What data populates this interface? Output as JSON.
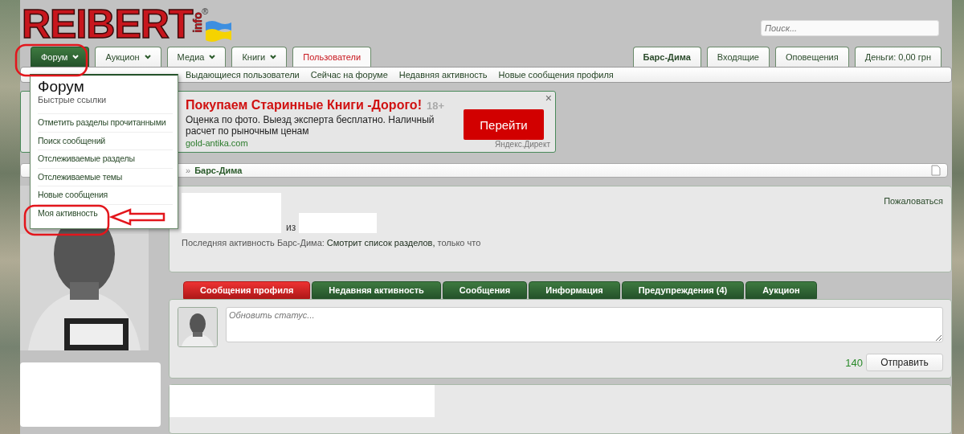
{
  "logo": {
    "wordmark": "REIBERT",
    "suffix": "info",
    "mark": "®"
  },
  "search": {
    "placeholder": "Поиск..."
  },
  "nav_tabs": [
    {
      "label": "Форум",
      "has_menu": true,
      "open": true,
      "selected": false
    },
    {
      "label": "Аукцион",
      "has_menu": true,
      "open": false,
      "selected": false
    },
    {
      "label": "Медиа",
      "has_menu": true,
      "open": false,
      "selected": false
    },
    {
      "label": "Книги",
      "has_menu": true,
      "open": false,
      "selected": false
    },
    {
      "label": "Пользователи",
      "has_menu": false,
      "open": false,
      "selected": true
    }
  ],
  "user_tabs": [
    {
      "label": "Барс-Дима",
      "kind": "account"
    },
    {
      "label": "Входящие",
      "kind": "link"
    },
    {
      "label": "Оповещения",
      "kind": "link"
    },
    {
      "label": "Деньги: 0,00 грн",
      "kind": "link"
    }
  ],
  "subnav": [
    "Выдающиеся пользователи",
    "Сейчас на форуме",
    "Недавняя активность",
    "Новые сообщения профиля"
  ],
  "menu": {
    "title": "Форум",
    "subtitle": "Быстрые ссылки",
    "items": [
      "Отметить разделы прочитанными",
      "Поиск сообщений",
      "Отслеживаемые разделы",
      "Отслеживаемые темы",
      "Новые сообщения",
      "Моя активность"
    ]
  },
  "ad": {
    "title": "Покупаем Старинные Книги -Дорого!",
    "age": "18+",
    "text": "Оценка по фото. Выезд эксперта бесплатно. Наличный расчет по рыночным ценам",
    "domain": "gold-antika.com",
    "button": "Перейти",
    "source": "Яндекс.Директ",
    "close": "×"
  },
  "breadcrumb": {
    "separator": "»",
    "items": [
      "Барс-Дима"
    ]
  },
  "profile": {
    "from_label": "из",
    "report": "Пожаловаться",
    "activity_label": "Последняя активность Барс-Дима:",
    "activity": "Смотрит список разделов,",
    "activity_time": "только что"
  },
  "profile_tabs": [
    {
      "label": "Сообщения профиля",
      "selected": true
    },
    {
      "label": "Недавняя активность",
      "selected": false
    },
    {
      "label": "Сообщения",
      "selected": false
    },
    {
      "label": "Информация",
      "selected": false
    },
    {
      "label": "Предупреждения (4)",
      "selected": false
    },
    {
      "label": "Аукцион",
      "selected": false
    }
  ],
  "status": {
    "placeholder": "Обновить статус...",
    "counter": "140",
    "submit": "Отправить"
  }
}
